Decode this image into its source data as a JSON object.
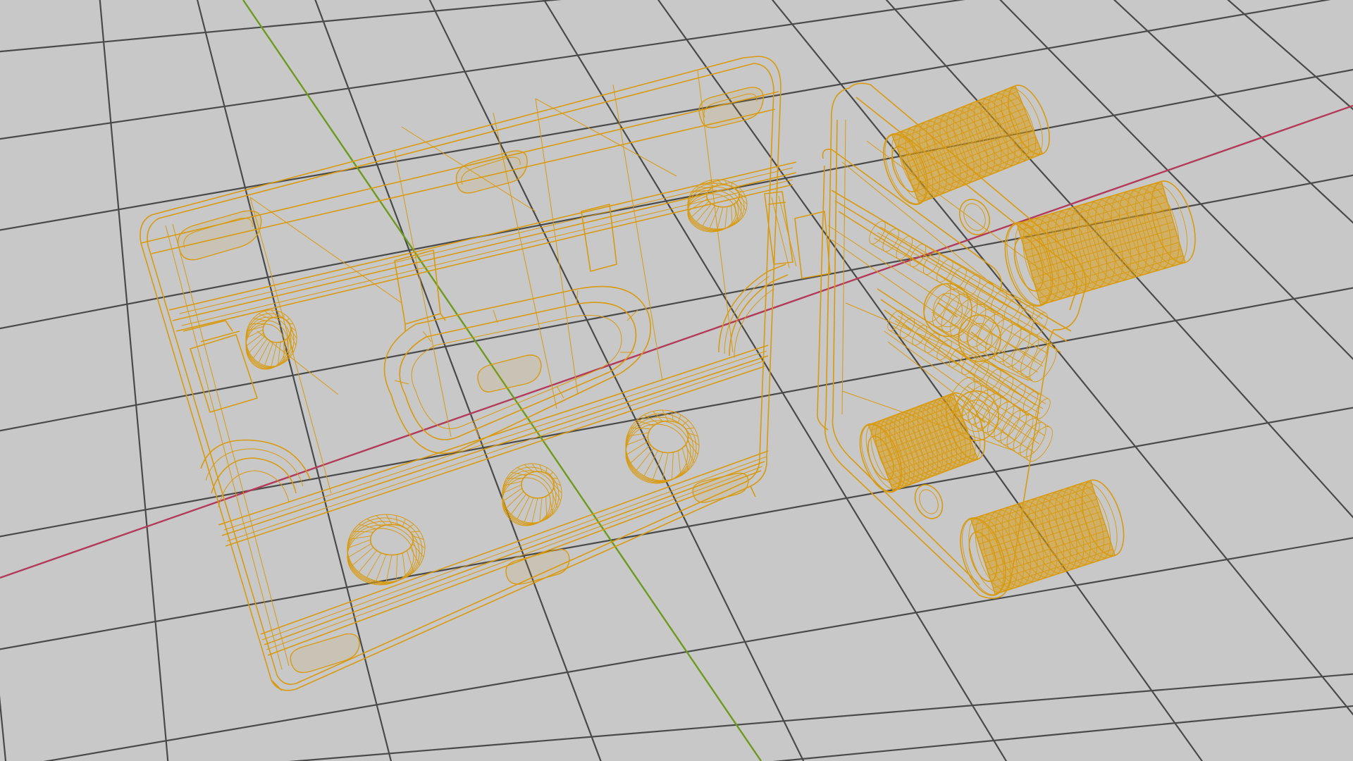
{
  "viewport": {
    "name": "3d-viewport",
    "render_mode": "wireframe",
    "background": "#c8c8c8"
  },
  "colors": {
    "background": "#c8c8c8",
    "grid": "#4a4a4a",
    "x_axis": "#b23a5a",
    "y_axis": "#6d9a1e",
    "wireframe": "#d89a10"
  },
  "scene": {
    "objects": [
      {
        "name": "base-plate",
        "type": "mesh",
        "selected": true
      },
      {
        "name": "hinge-bracket",
        "type": "mesh",
        "selected": true
      },
      {
        "name": "knurled-knob",
        "type": "mesh",
        "count": 4,
        "selected": true
      }
    ]
  }
}
